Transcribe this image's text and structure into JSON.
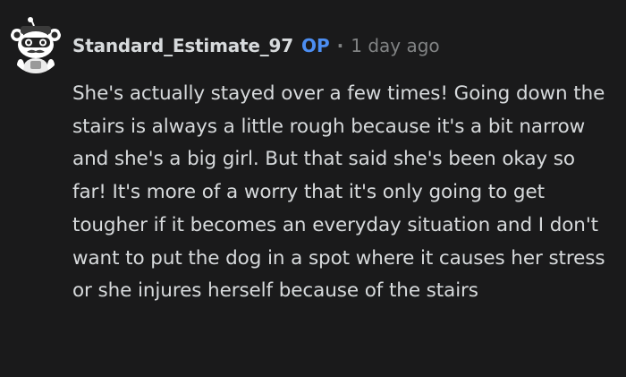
{
  "comment": {
    "author": "Standard_Estimate_97",
    "badge": "OP",
    "separator": "·",
    "timestamp": "1 day ago",
    "avatar_icon": "snoo-avatar-icon",
    "body": "She's actually stayed over a few times! Going down the stairs is always a little rough because it's a bit narrow and she's a big girl. But that said she's been okay so far! It's more of a worry that it's only going to get tougher if it becomes an everyday situation and I don't want to put the dog in a spot where it causes her stress or she injures herself because of the stairs"
  },
  "colors": {
    "background": "#1a1a1b",
    "text": "#d7dadc",
    "muted": "#818384",
    "op_accent": "#4c8ef2"
  }
}
